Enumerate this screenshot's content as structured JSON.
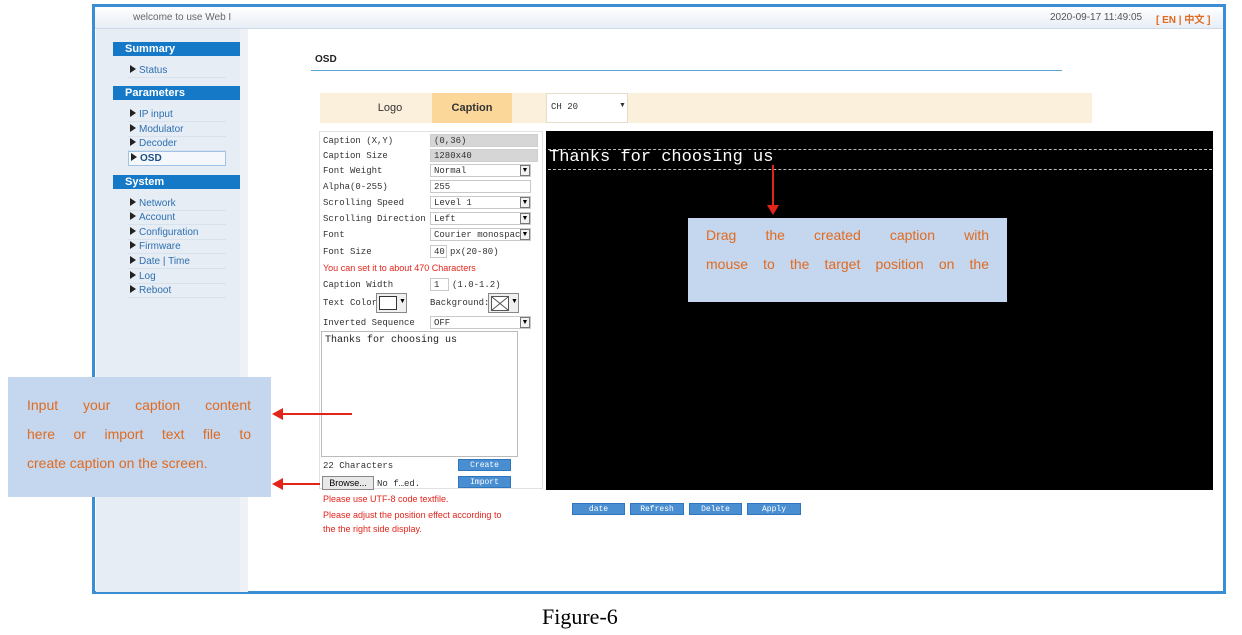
{
  "header": {
    "welcome": "welcome to use Web I",
    "datetime": "2020-09-17 11:49:05",
    "lang": "[ EN | 中文 ]"
  },
  "sidebar": {
    "summary": {
      "title": "Summary",
      "items": [
        "Status"
      ]
    },
    "parameters": {
      "title": "Parameters",
      "items": [
        "IP input",
        "Modulator",
        "Decoder",
        "OSD"
      ]
    },
    "system": {
      "title": "System",
      "items": [
        "Network",
        "Account",
        "Configuration",
        "Firmware",
        "Date | Time",
        "Log",
        "Reboot"
      ]
    }
  },
  "page": {
    "title": "OSD"
  },
  "tabs": {
    "logo": "Logo",
    "caption": "Caption",
    "channel": "CH 20"
  },
  "form": {
    "caption_xy": {
      "label": "Caption (X,Y)",
      "value": "(0,36)"
    },
    "caption_size": {
      "label": "Caption Size",
      "value": "1280x40"
    },
    "font_weight": {
      "label": "Font Weight",
      "value": "Normal"
    },
    "alpha": {
      "label": "Alpha(0-255)",
      "value": "255"
    },
    "scroll_speed": {
      "label": "Scrolling Speed",
      "value": "Level 1"
    },
    "scroll_dir": {
      "label": "Scrolling Direction",
      "value": "Left"
    },
    "font": {
      "label": "Font",
      "value": "Courier monospac"
    },
    "font_size": {
      "label": "Font Size",
      "value": "40",
      "unit": "px(20-80)"
    },
    "limit_note": "You can set it to about 470 Characters",
    "caption_width": {
      "label": "Caption Width",
      "value": "1",
      "range": "(1.0-1.2)"
    },
    "text_color": {
      "label": "Text Color"
    },
    "background": {
      "label": "Background:"
    },
    "inverted": {
      "label": "Inverted Sequence",
      "value": "OFF"
    },
    "caption_text": "Thanks for choosing us",
    "char_count": "22 Characters",
    "create_btn": "Create",
    "import_btn": "Import",
    "browse_btn": "Browse...",
    "file_label": "No f…ed.",
    "notes": [
      "Please use UTF-8 code textfile.",
      "Please adjust the position effect according to",
      "the the right side display."
    ]
  },
  "preview": {
    "caption": "Thanks for choosing us"
  },
  "actions": {
    "update": "date",
    "refresh": "Refresh",
    "delete": "Delete",
    "apply": "Apply"
  },
  "callouts": {
    "drag_lines": [
      "Drag the created caption with",
      "mouse to the target position on the"
    ],
    "input_lines": [
      "Input your caption content",
      "here or import text file to",
      "create caption on the screen."
    ]
  },
  "figure_caption": "Figure-6"
}
